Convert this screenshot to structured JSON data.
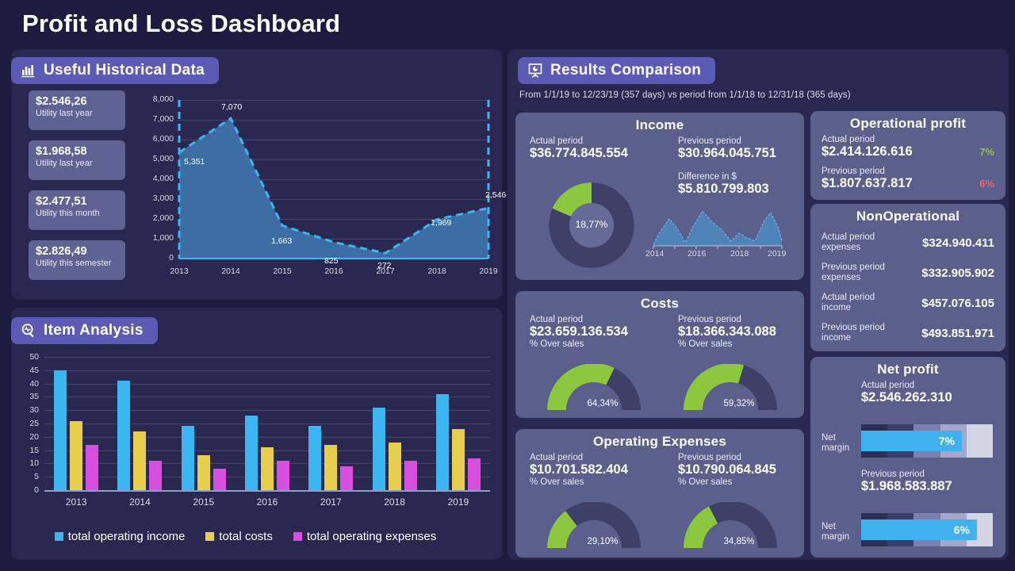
{
  "page": {
    "title": "Profit and Loss Dashboard",
    "colors": {
      "background": "#1d1b3f",
      "panel": "#2a2850",
      "header": "#5b5bb5",
      "card": "#5b5f8c",
      "green": "#8dc63f",
      "red": "#f0656f",
      "blue": "#3ab6f0",
      "yellow": "#e8ce4d",
      "magenta": "#d84fe0"
    }
  },
  "panels": {
    "historical": {
      "title": "Useful Historical Data",
      "icon": "bar-chart-icon"
    },
    "item": {
      "title": "Item Analysis",
      "icon": "magnifier-pulse-icon"
    },
    "results": {
      "title": "Results Comparison",
      "icon": "presentation-chart-icon",
      "subtitle": "From 1/1/19 to 12/23/19 (357 days) vs period from  1/1/18 to 12/31/18 (365 days)"
    }
  },
  "kpis": [
    {
      "value": "$2.546,26",
      "label": "Utility last year"
    },
    {
      "value": "$1.968,58",
      "label": "Utility last year"
    },
    {
      "value": "$2.477,51",
      "label": "Utility this month"
    },
    {
      "value": "$2.826,49",
      "label": "Utility this semester"
    }
  ],
  "chart_data": [
    {
      "type": "area",
      "title": "Useful Historical Data",
      "xlabel": "",
      "ylabel": "",
      "categories": [
        "2013",
        "2014",
        "2015",
        "2016",
        "2017",
        "2018",
        "2019"
      ],
      "values": [
        5351,
        7070,
        1663,
        825,
        272,
        1969,
        2546
      ],
      "data_labels": [
        "5,351",
        "7,070",
        "1,663",
        "825",
        "272",
        "1,969",
        "2,546"
      ],
      "yticks": [
        "0",
        "1,000",
        "2,000",
        "3,000",
        "4,000",
        "5,000",
        "6,000",
        "7,000",
        "8,000"
      ],
      "ylim": [
        0,
        8000
      ],
      "grid": true,
      "legend": "none",
      "line_color": "#3ab6f0",
      "fill_color": "#3c6ea5",
      "line_style": "dashed"
    },
    {
      "type": "bar",
      "title": "Item Analysis",
      "xlabel": "",
      "ylabel": "",
      "categories": [
        "2013",
        "2014",
        "2015",
        "2016",
        "2017",
        "2018",
        "2019"
      ],
      "series": [
        {
          "name": "total operating income",
          "color": "#3ab6f0",
          "values": [
            45,
            41,
            24,
            28,
            24,
            31,
            36
          ]
        },
        {
          "name": "total costs",
          "color": "#e8ce4d",
          "values": [
            26,
            22,
            13,
            16,
            17,
            18,
            23
          ]
        },
        {
          "name": "total operating expenses",
          "color": "#d84fe0",
          "values": [
            17,
            11,
            8,
            11,
            9,
            11,
            12
          ]
        }
      ],
      "yticks": [
        "0",
        "5",
        "10",
        "15",
        "20",
        "25",
        "30",
        "35",
        "40",
        "45",
        "50"
      ],
      "ylim": [
        0,
        50
      ],
      "grid": true,
      "legend": "bottom"
    },
    {
      "type": "area",
      "title": "Income sparkline",
      "categories": [
        "2014",
        "2016",
        "2018",
        "2019"
      ],
      "values": [
        10,
        42,
        62,
        30,
        8,
        55,
        78,
        62,
        50,
        22,
        38,
        26,
        18,
        58,
        72,
        48,
        30
      ],
      "xticks": [
        "2014",
        "2016",
        "2018",
        "2019"
      ],
      "grid": false,
      "legend": "none",
      "fill_color": "#4e84b8"
    },
    {
      "type": "pie",
      "title": "Income variation donut",
      "labels": [
        "variation",
        "remainder"
      ],
      "values": [
        18.77,
        81.23
      ],
      "center_label": "18,77%",
      "colors": [
        "#8dc63f",
        "#3f4068"
      ]
    },
    {
      "type": "pie",
      "title": "Costs actual gauge",
      "labels": [
        "% Over sales",
        "remainder"
      ],
      "values": [
        64.34,
        35.66
      ],
      "center_label": "64,34%",
      "colors": [
        "#8dc63f",
        "#3f4068"
      ]
    },
    {
      "type": "pie",
      "title": "Costs previous gauge",
      "labels": [
        "% Over sales",
        "remainder"
      ],
      "values": [
        59.32,
        40.68
      ],
      "center_label": "59,32%",
      "colors": [
        "#8dc63f",
        "#3f4068"
      ]
    },
    {
      "type": "pie",
      "title": "Operating expenses actual gauge",
      "labels": [
        "% Over sales",
        "remainder"
      ],
      "values": [
        29.1,
        70.9
      ],
      "center_label": "29,10%",
      "colors": [
        "#8dc63f",
        "#3f4068"
      ]
    },
    {
      "type": "pie",
      "title": "Operating expenses previous gauge",
      "labels": [
        "% Over sales",
        "remainder"
      ],
      "values": [
        34.85,
        65.15
      ],
      "center_label": "34,85%",
      "colors": [
        "#8dc63f",
        "#3f4068"
      ]
    },
    {
      "type": "bar",
      "title": "Net margin bullets",
      "categories": [
        "Actual period",
        "Previous period"
      ],
      "values": [
        7,
        6
      ],
      "data_labels": [
        "7%",
        "6%"
      ],
      "ylim": [
        0,
        10
      ],
      "legend": "none",
      "fill_color": "#3fb1ef"
    }
  ],
  "bar_legend": [
    {
      "label": "total operating income",
      "color": "#3ab6f0"
    },
    {
      "label": "total costs",
      "color": "#e8ce4d"
    },
    {
      "label": "total operating expenses",
      "color": "#d84fe0"
    }
  ],
  "income": {
    "title": "Income",
    "actual_label": "Actual period",
    "actual_value": "$36.774.845.554",
    "previous_label": "Previous period",
    "previous_value": "$30.964.045.751",
    "difference_label": "Difference in $",
    "difference_value": "$5.810.799.803",
    "donut_pct": "18,77%",
    "spark_ticks": [
      "2014",
      "2016",
      "2018",
      "2019"
    ]
  },
  "costs": {
    "title": "Costs",
    "actual_label": "Actual period",
    "actual_value": "$23.659.136.534",
    "actual_over_label": "% Over sales",
    "actual_pct": "64,34%",
    "previous_label": "Previous period",
    "previous_value": "$18.366.343.088",
    "previous_over_label": "% Over sales",
    "previous_pct": "59,32%"
  },
  "operating_expenses": {
    "title": "Operating Expenses",
    "actual_label": "Actual period",
    "actual_value": "$10.701.582.404",
    "actual_over_label": "% Over sales",
    "actual_pct": "29,10%",
    "previous_label": "Previous period",
    "previous_value": "$10.790.064.845",
    "previous_over_label": "% Over sales",
    "previous_pct": "34,85%"
  },
  "operational_profit": {
    "title": "Operational profit",
    "actual_label": "Actual period",
    "actual_value": "$2.414.126.616",
    "actual_pct": "7%",
    "previous_label": "Previous period",
    "previous_value": "$1.807.637.817",
    "previous_pct": "6%"
  },
  "nonoperational": {
    "title": "NonOperational",
    "rows": [
      {
        "label": "Actual period expenses",
        "value": "$324.940.411"
      },
      {
        "label": "Previous period expenses",
        "value": "$332.905.902"
      },
      {
        "label": "Actual period income",
        "value": "$457.076.105"
      },
      {
        "label": "Previous period income",
        "value": "$493.851.971"
      }
    ]
  },
  "net_profit": {
    "title": "Net profit",
    "actual_label": "Actual period",
    "actual_value": "$2.546.262.310",
    "actual_margin_label": "Net margin",
    "actual_margin_pct": "7%",
    "previous_label": "Previous period",
    "previous_value": "$1.968.583.887",
    "previous_margin_label": "Net margin",
    "previous_margin_pct": "6%"
  }
}
